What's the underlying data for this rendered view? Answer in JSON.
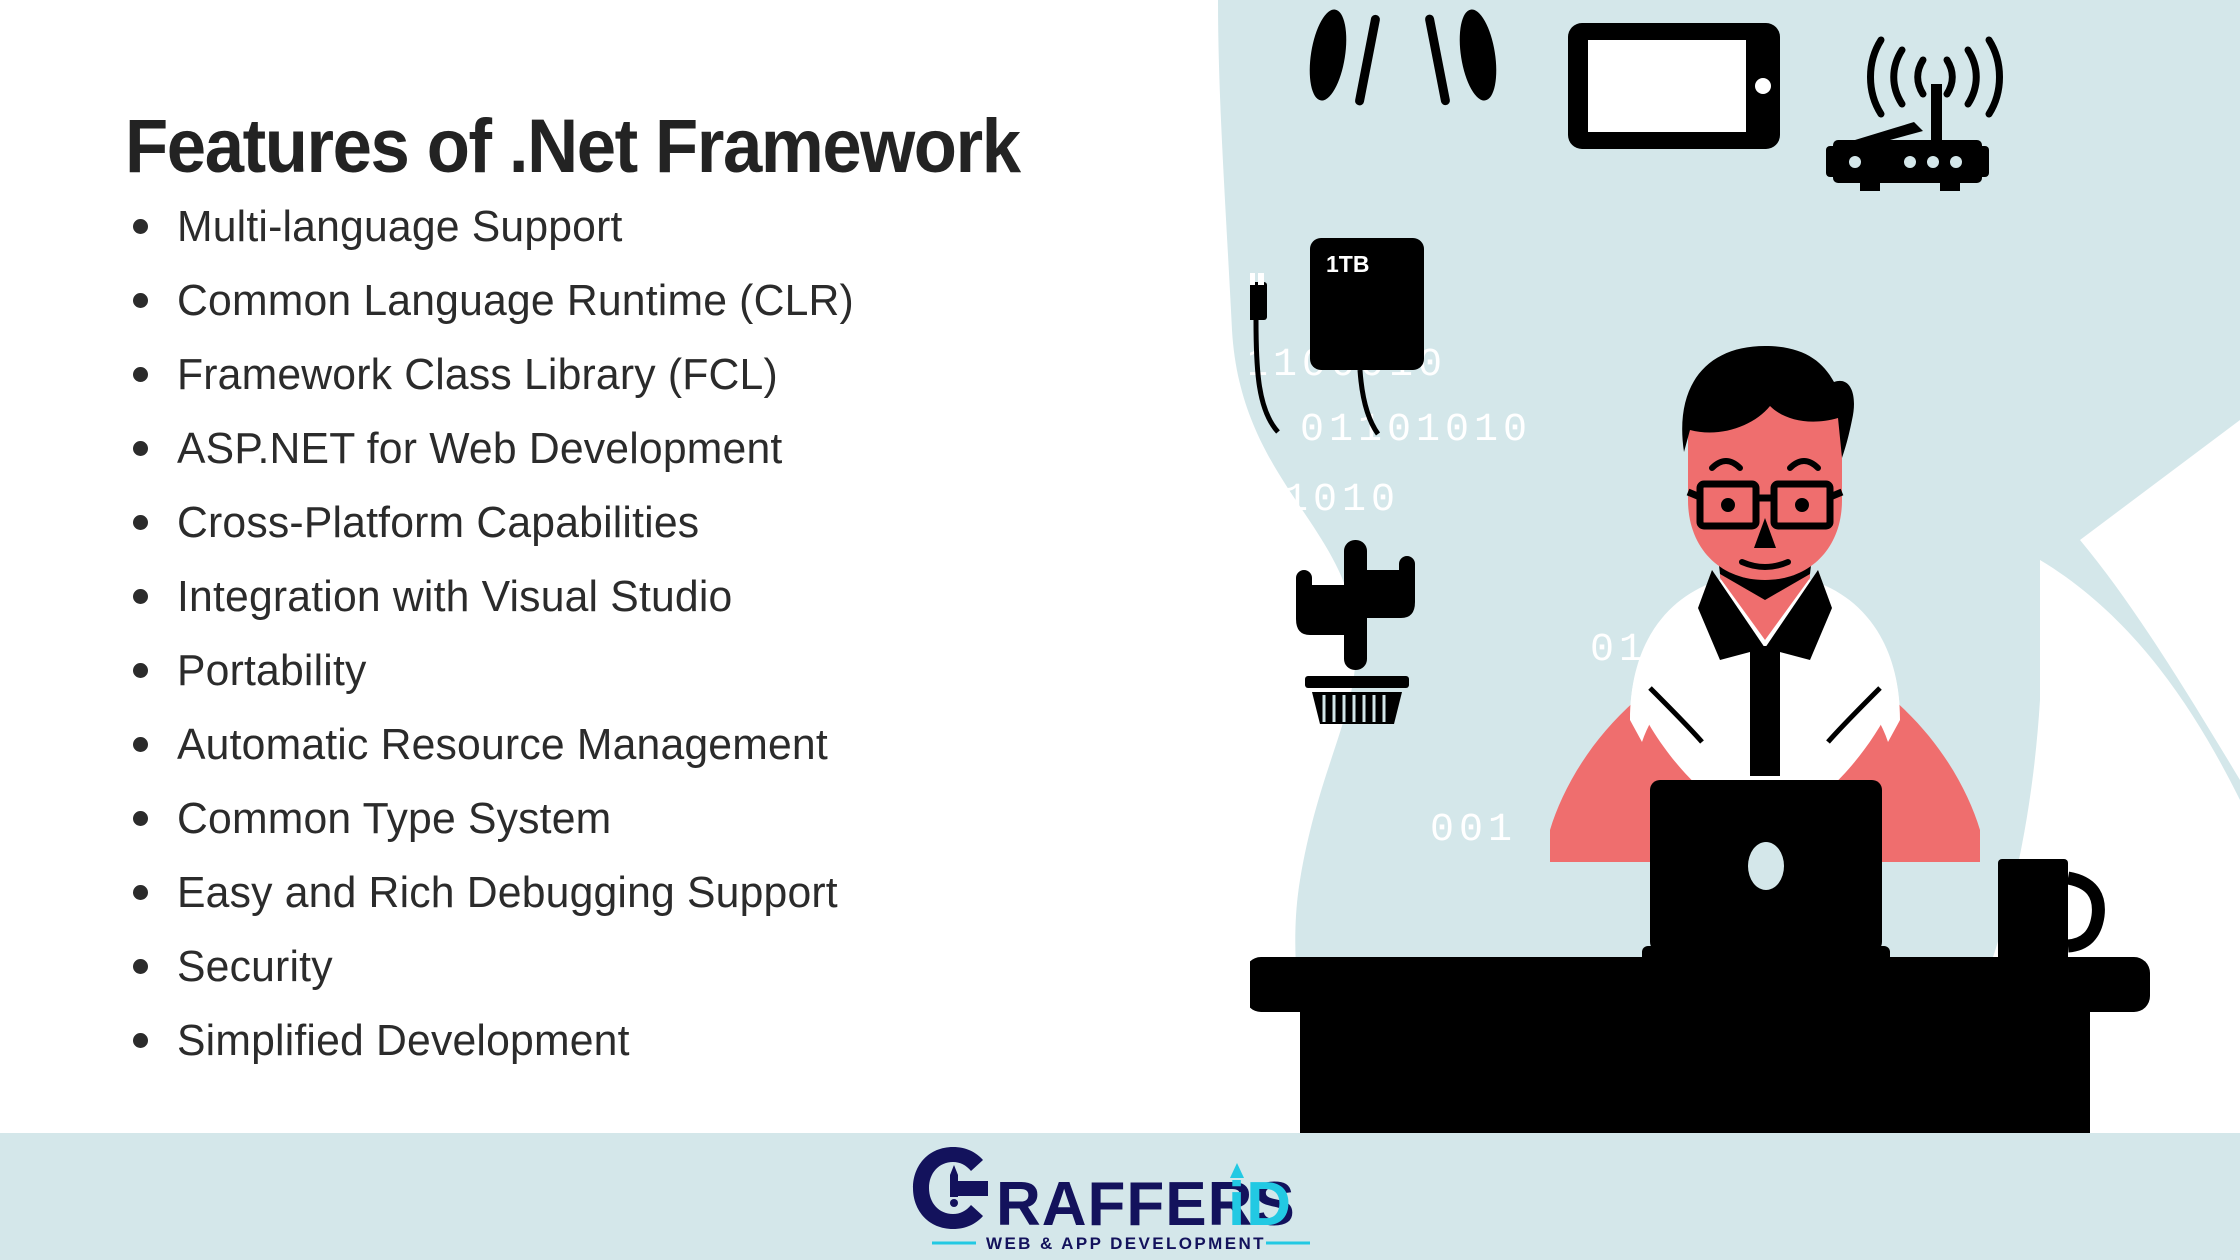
{
  "slide": {
    "title": "Features of .Net Framework",
    "background_color": "#ffffff",
    "blob_color": "#d4e7ea",
    "text_color": "#2b2b2b",
    "accent_coral": "#ef6e6e"
  },
  "features": [
    {
      "label": "Multi-language Support"
    },
    {
      "label": "Common Language Runtime (CLR)"
    },
    {
      "label": "Framework Class Library (FCL)"
    },
    {
      "label": "ASP.NET for Web Development"
    },
    {
      "label": "Cross-Platform Capabilities"
    },
    {
      "label": "Integration with Visual Studio"
    },
    {
      "label": "Portability"
    },
    {
      "label": "Automatic Resource Management"
    },
    {
      "label": "Common Type System"
    },
    {
      "label": "Easy and Rich Debugging Support"
    },
    {
      "label": "Security"
    },
    {
      "label": "Simplified Development"
    }
  ],
  "illustration": {
    "name": "developer-at-desk-illustration",
    "hard_drive_label": "1TB",
    "binary_strings": [
      "11100010",
      "01101010",
      "01010",
      "01001",
      "001"
    ],
    "colors": {
      "skin": "#ef6e6e",
      "ink": "#000000",
      "shirt": "#ffffff",
      "binary": "#ffffff"
    },
    "objects": [
      "tablet",
      "wifi-router",
      "headphones",
      "external-hard-drive",
      "cactus-plant",
      "laptop",
      "coffee-mug",
      "desk"
    ]
  },
  "footer": {
    "background_color": "#d4e7ea",
    "logo": {
      "brand_main": "RAFFERS",
      "brand_mark": "G",
      "brand_accent": "iD",
      "tagline": "WEB & APP DEVELOPMENT",
      "navy": "#13125c",
      "cyan": "#22c9e3"
    }
  }
}
